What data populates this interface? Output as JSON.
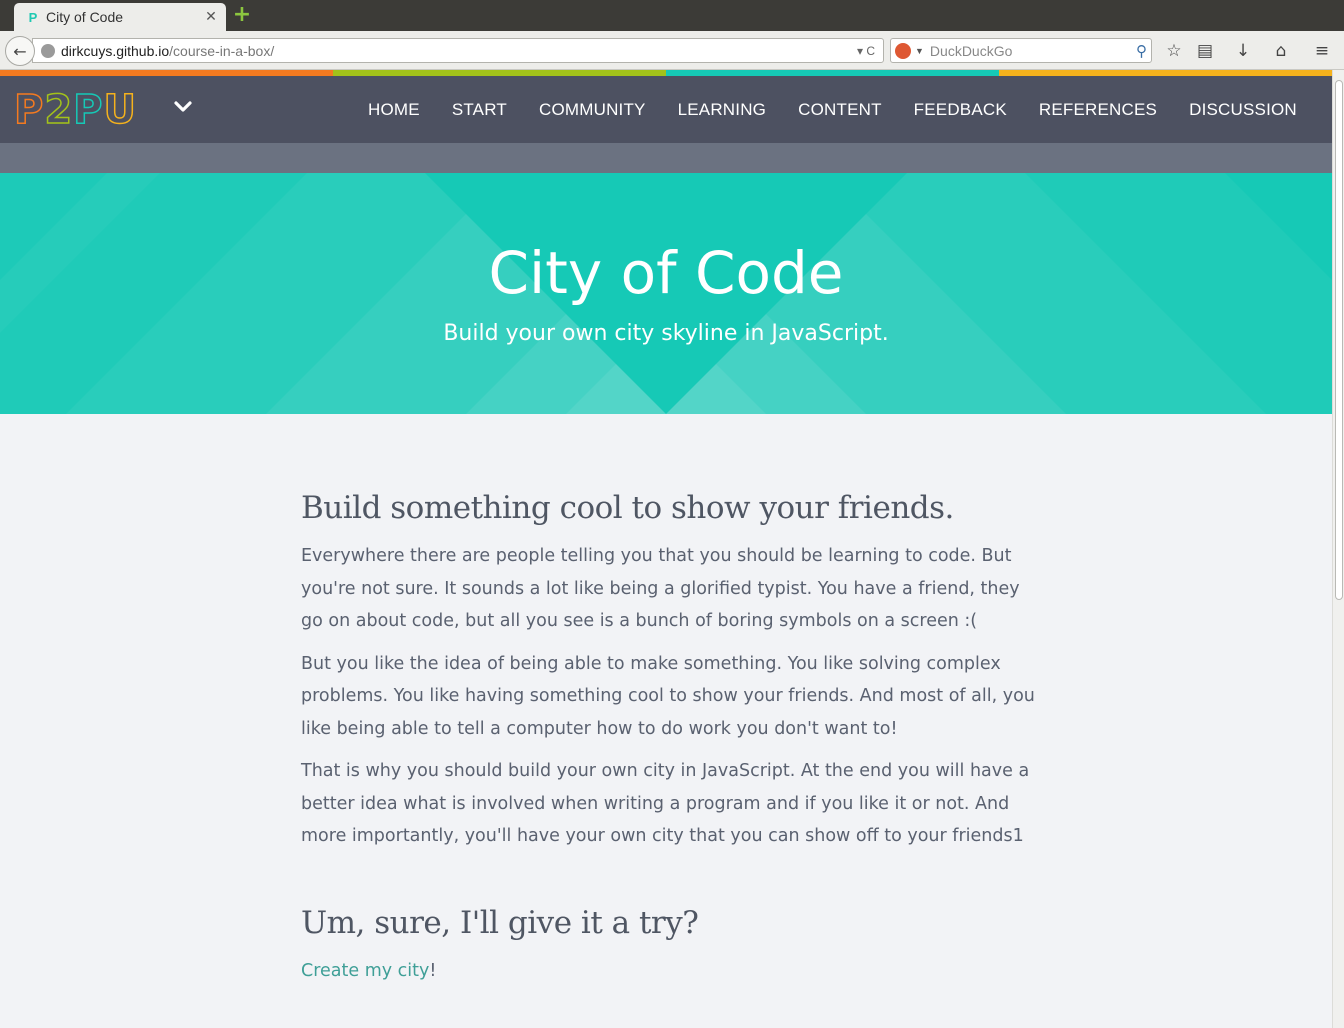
{
  "browser": {
    "tab_title": "City of Code",
    "tab_close": "✕",
    "new_tab": "+",
    "back": "←",
    "url_host": "dirkcuys.github.io",
    "url_path": "/course-in-a-box/",
    "url_tools": "▾ C",
    "search_placeholder": "DuckDuckGo",
    "search_glass": "🔍",
    "bookmark_star": "☆",
    "reading_list": "▤",
    "download": "↓",
    "home": "⌂",
    "menu": "≡"
  },
  "colors": {
    "strip": [
      "#f47a20",
      "#a3c21a",
      "#16c9b6",
      "#f5b21d"
    ],
    "header_bg": "#4d5161",
    "hero_bg": "#16c9b6",
    "link": "#3f9f97"
  },
  "site": {
    "logo_letters": [
      "P",
      "2",
      "P",
      "U"
    ],
    "logo_colors": [
      "#f47a20",
      "#a3c21a",
      "#16c9b6",
      "#f5b21d"
    ],
    "menu_chevron": "⌄",
    "nav": [
      "HOME",
      "START",
      "COMMUNITY",
      "LEARNING",
      "CONTENT",
      "FEEDBACK",
      "REFERENCES",
      "DISCUSSION"
    ]
  },
  "hero": {
    "title": "City of Code",
    "subtitle": "Build your own city skyline in JavaScript."
  },
  "content": {
    "heading1": "Build something cool to show your friends.",
    "para1": "Everywhere there are people telling you that you should be learning to code. But you're not sure. It sounds a lot like being a glorified typist. You have a friend, they go on about code, but all you see is a bunch of boring symbols on a screen :(",
    "para2": "But you like the idea of being able to make something. You like solving complex problems. You like having something cool to show your friends. And most of all, you like being able to tell a computer how to do work you don't want to!",
    "para3": "That is why you should build your own city in JavaScript. At the end you will have a better idea what is involved when writing a program and if you like it or not. And more importantly, you'll have your own city that you can show off to your friends1",
    "heading2": "Um, sure, I'll give it a try?",
    "cta_link": "Create my city",
    "cta_suffix": "!"
  }
}
